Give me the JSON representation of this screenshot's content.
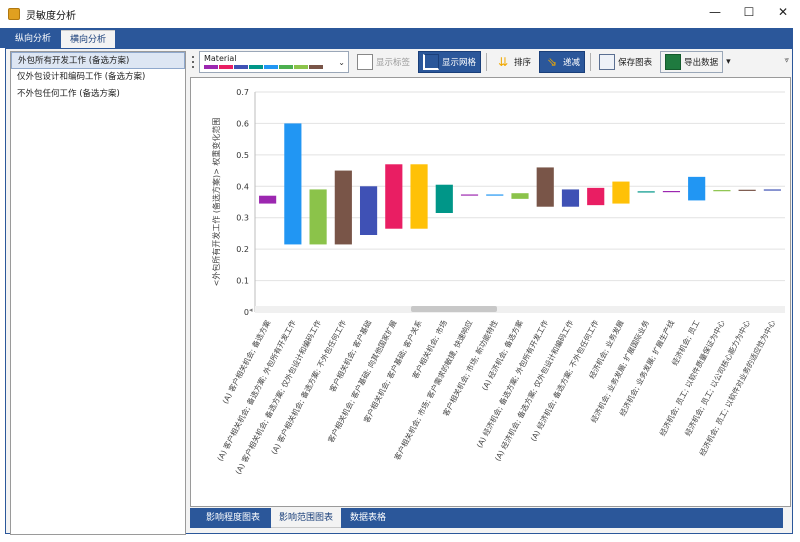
{
  "window": {
    "title": "灵敏度分析",
    "controls": {
      "minimize": "—",
      "maximize": "☐",
      "close": "✕"
    }
  },
  "tabs": [
    {
      "label": "纵向分析"
    },
    {
      "label": "横向分析",
      "active": true
    }
  ],
  "left_panel": {
    "items": [
      {
        "label": "外包所有开发工作 (备选方案)",
        "selected": true
      },
      {
        "label": "仅外包设计和编码工作 (备选方案)"
      },
      {
        "label": "不外包任何工作 (备选方案)"
      }
    ]
  },
  "toolbar": {
    "palette_label": "Material",
    "palette_colors": [
      "#9c27b0",
      "#e91e63",
      "#3f51b5",
      "#009688",
      "#2196f3",
      "#4caf50",
      "#8bc34a",
      "#795548"
    ],
    "show_labels": "显示标签",
    "show_grid": "显示网格",
    "sort": "排序",
    "decrease": "递减",
    "save_chart": "保存图表",
    "export_data": "导出数据",
    "overflow": "▾"
  },
  "chart_data": {
    "type": "bar",
    "ylabel": "<外包所有开发工作 (备选方案)> 权重变化范围",
    "ylim": [
      0,
      0.7
    ],
    "yticks": [
      "0",
      "0.1",
      "0.2",
      "0.3",
      "0.4",
      "0.5",
      "0.6",
      "0.7"
    ],
    "grid": true,
    "categories": [
      "(A) 客户相关机会; 备选方案",
      "(A) 客户相关机会; 备选方案; 外包所有开发工作",
      "(A) 客户相关机会; 备选方案; 仅外包设计和编码工作",
      "(A) 客户相关机会; 备选方案; 不外包任何工作",
      "客户相关机会; 客户基础",
      "客户相关机会; 客户基础; 向其他国家扩展",
      "客户相关机会; 客户基础; 客户关系",
      "客户相关机会; 市场",
      "客户相关机会; 市场; 客户需求的敏捷, 快速响应",
      "客户相关机会; 市场; 新功能特性",
      "(A) 经济机会; 备选方案",
      "(A) 经济机会; 备选方案; 外包所有开发工作",
      "(A) 经济机会; 备选方案; 仅外包设计和编码工作",
      "(A) 经济机会; 备选方案; 不外包任何工作",
      "经济机会; 业务发展",
      "经济机会; 业务发展; 扩展国际业务",
      "经济机会; 业务发展; 扩展生产线",
      "经济机会; 员工",
      "经济机会; 员工; 以软件质量保证为中心",
      "经济机会; 员工; 以公司核心能力为中心",
      "经济机会; 员工; 以软件对业务的适应性为中心"
    ],
    "ranges": [
      [
        0.345,
        0.37
      ],
      [
        0.215,
        0.6
      ],
      [
        0.215,
        0.39
      ],
      [
        0.215,
        0.45
      ],
      [
        0.245,
        0.4
      ],
      [
        0.265,
        0.47
      ],
      [
        0.265,
        0.47
      ],
      [
        0.315,
        0.405
      ],
      [
        0.373,
        0.374
      ],
      [
        0.373,
        0.374
      ],
      [
        0.36,
        0.378
      ],
      [
        0.335,
        0.46
      ],
      [
        0.335,
        0.39
      ],
      [
        0.34,
        0.395
      ],
      [
        0.345,
        0.415
      ],
      [
        0.383,
        0.384
      ],
      [
        0.384,
        0.385
      ],
      [
        0.355,
        0.43
      ],
      [
        0.387,
        0.388
      ],
      [
        0.388,
        0.389
      ],
      [
        0.389,
        0.39
      ]
    ],
    "colors": [
      "#9c27b0",
      "#2196f3",
      "#8bc34a",
      "#795548",
      "#3f51b5",
      "#e91e63",
      "#ffc107",
      "#009688",
      "#9c27b0",
      "#2196f3",
      "#8bc34a",
      "#795548",
      "#3f51b5",
      "#e91e63",
      "#ffc107",
      "#009688",
      "#9c27b0",
      "#2196f3",
      "#8bc34a",
      "#795548",
      "#3f51b5"
    ]
  },
  "bottom_tabs": [
    {
      "label": "影响程度图表"
    },
    {
      "label": "影响范围图表",
      "active": true
    },
    {
      "label": "数据表格"
    }
  ]
}
